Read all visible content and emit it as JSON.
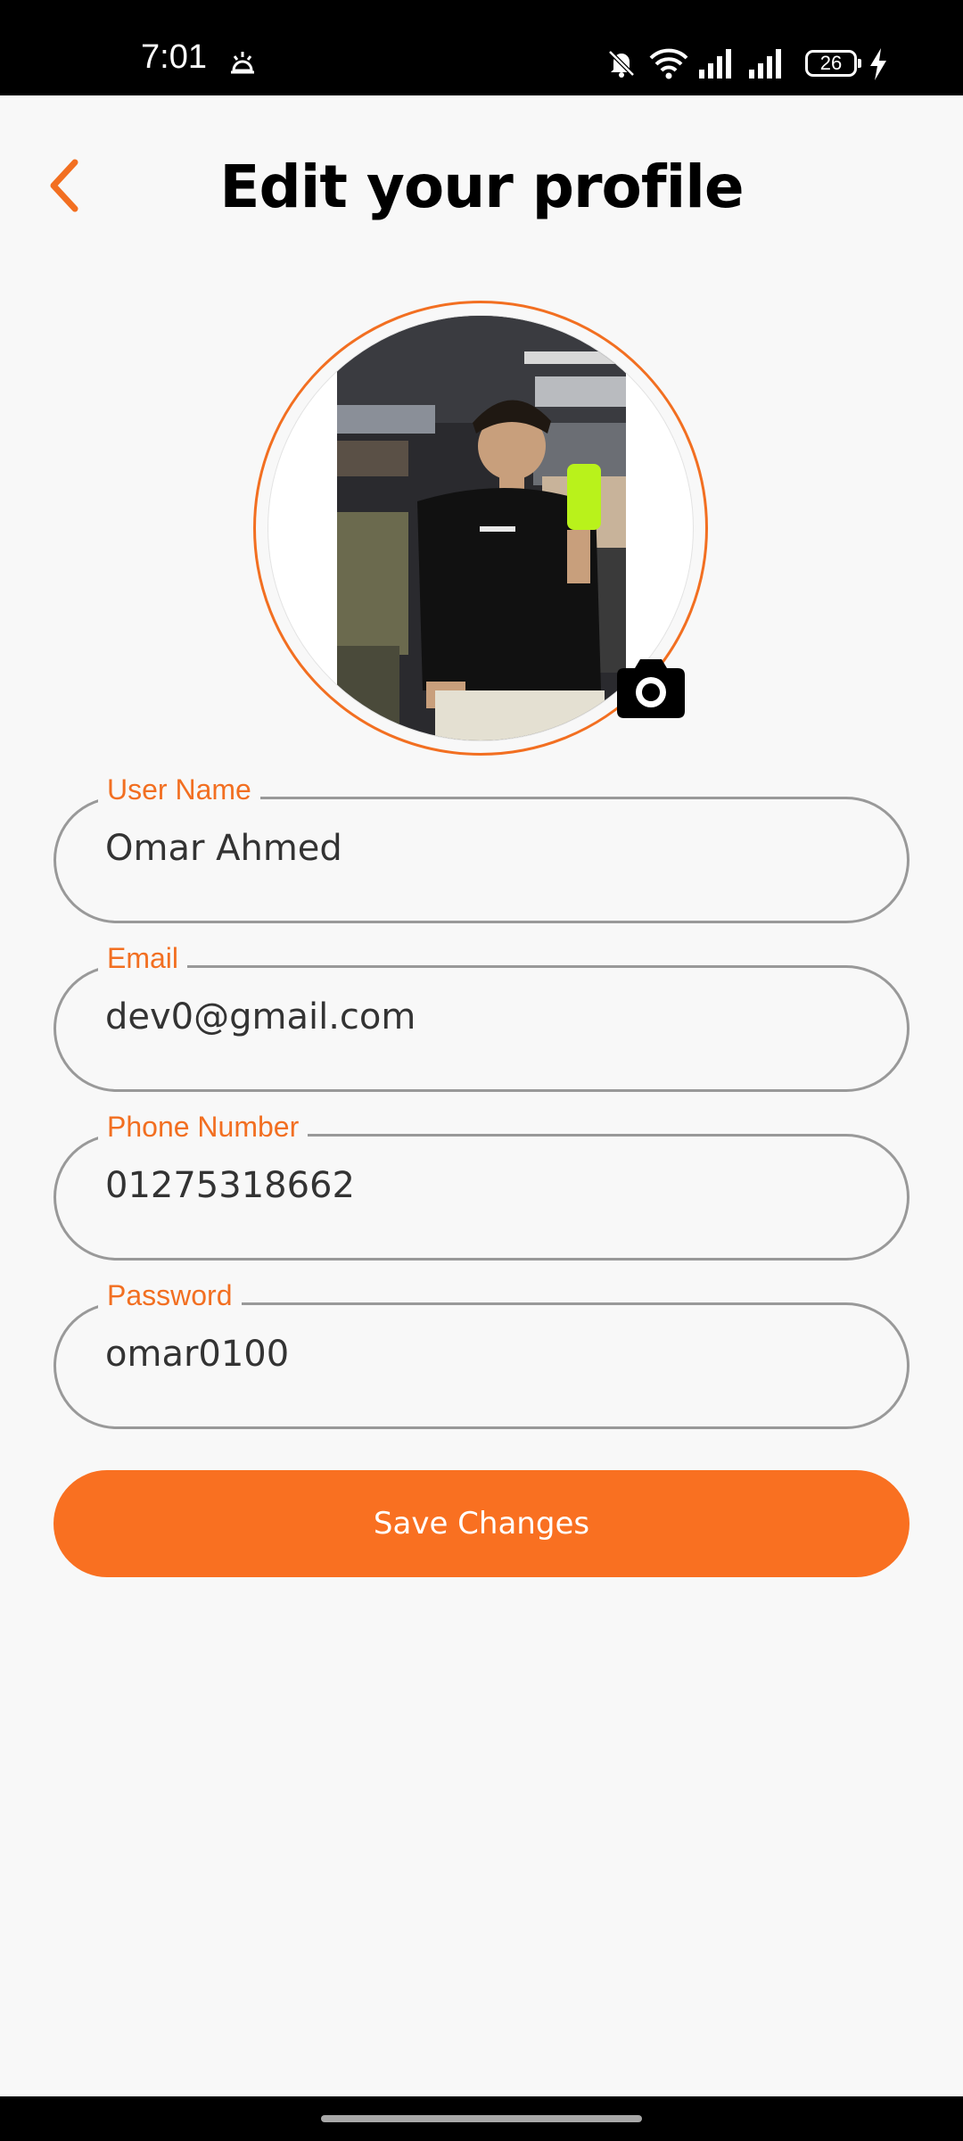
{
  "status_bar": {
    "time": "7:01",
    "battery": "26",
    "icons": [
      "alarm-icon",
      "bell-off-icon",
      "wifi-icon",
      "signal-icon",
      "signal-icon",
      "battery-icon",
      "charging-icon"
    ]
  },
  "header": {
    "title": "Edit your profile",
    "back_icon": "chevron-left-icon"
  },
  "profile": {
    "camera_icon": "camera-icon"
  },
  "form": {
    "fields": [
      {
        "label": "User Name",
        "value": "Omar Ahmed"
      },
      {
        "label": "Email",
        "value": "dev0@gmail.com"
      },
      {
        "label": "Phone Number",
        "value": "01275318662"
      },
      {
        "label": "Password",
        "value": "omar0100"
      }
    ],
    "save_label": "Save Changes"
  },
  "colors": {
    "accent": "#f97021",
    "label": "#f26f21",
    "border": "#999999",
    "background": "#f8f8f8"
  }
}
